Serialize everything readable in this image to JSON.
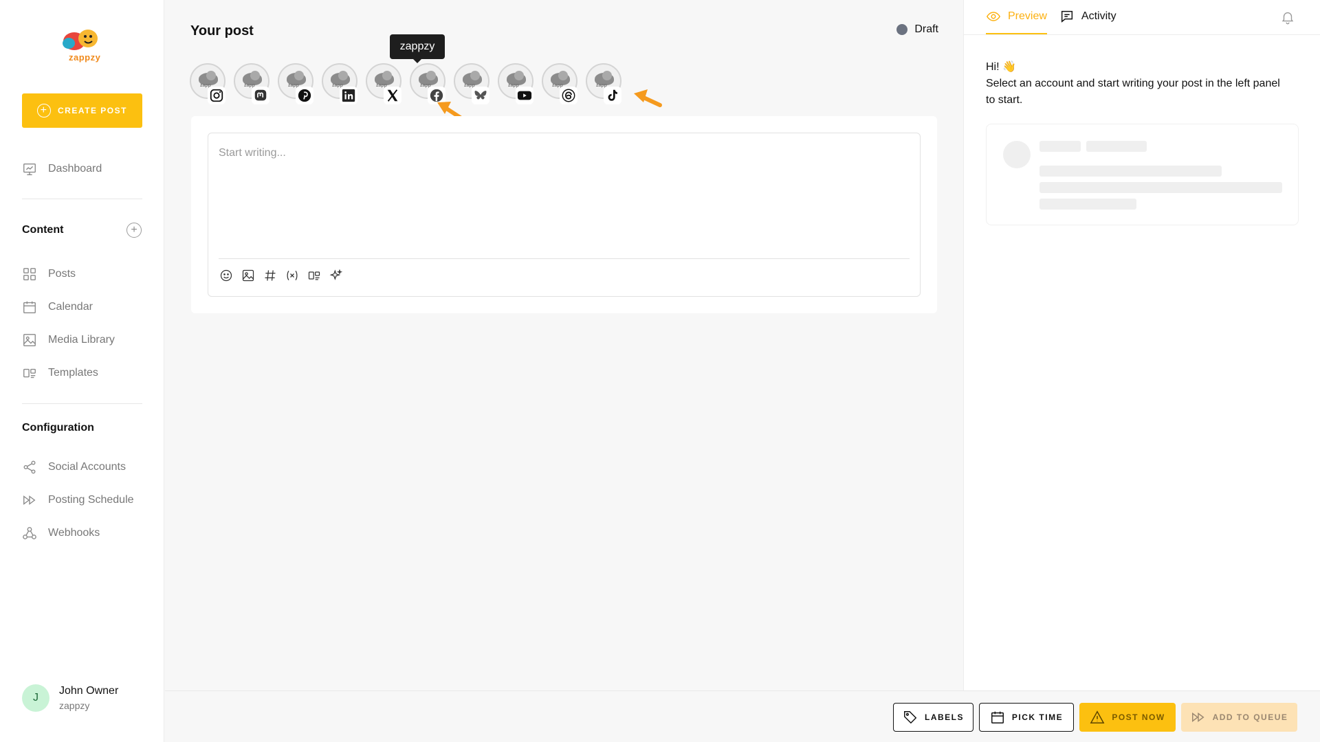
{
  "brand": {
    "logo_text": "zappzy",
    "accent": "#fcc010"
  },
  "sidebar": {
    "create_label": "CREATE POST",
    "dashboard": "Dashboard",
    "content_title": "Content",
    "content_items": [
      "Posts",
      "Calendar",
      "Media Library",
      "Templates"
    ],
    "config_title": "Configuration",
    "config_items": [
      "Social Accounts",
      "Posting Schedule",
      "Webhooks"
    ],
    "user": {
      "initial": "J",
      "name": "John Owner",
      "org": "zappzy"
    }
  },
  "main": {
    "title": "Your post",
    "status": "Draft",
    "tooltip": "zappzy",
    "accounts": [
      {
        "network": "instagram-icon"
      },
      {
        "network": "mastodon-icon"
      },
      {
        "network": "pinterest-icon"
      },
      {
        "network": "linkedin-icon"
      },
      {
        "network": "x-icon"
      },
      {
        "network": "facebook-icon"
      },
      {
        "network": "bluesky-icon"
      },
      {
        "network": "youtube-icon"
      },
      {
        "network": "threads-icon"
      },
      {
        "network": "tiktok-icon"
      }
    ],
    "editor": {
      "placeholder": "Start writing...",
      "tools": [
        "emoji-icon",
        "image-icon",
        "hashtag-icon",
        "variable-icon",
        "template-icon",
        "ai-sparkle-icon"
      ]
    }
  },
  "right": {
    "tabs": [
      "Preview",
      "Activity"
    ],
    "greeting_line1": "Hi! 👋",
    "greeting_line2": "Select an account and start writing your post in the left panel to start."
  },
  "bottom": {
    "labels": "LABELS",
    "pick_time": "PICK TIME",
    "post_now": "POST NOW",
    "add_queue": "ADD TO QUEUE"
  }
}
